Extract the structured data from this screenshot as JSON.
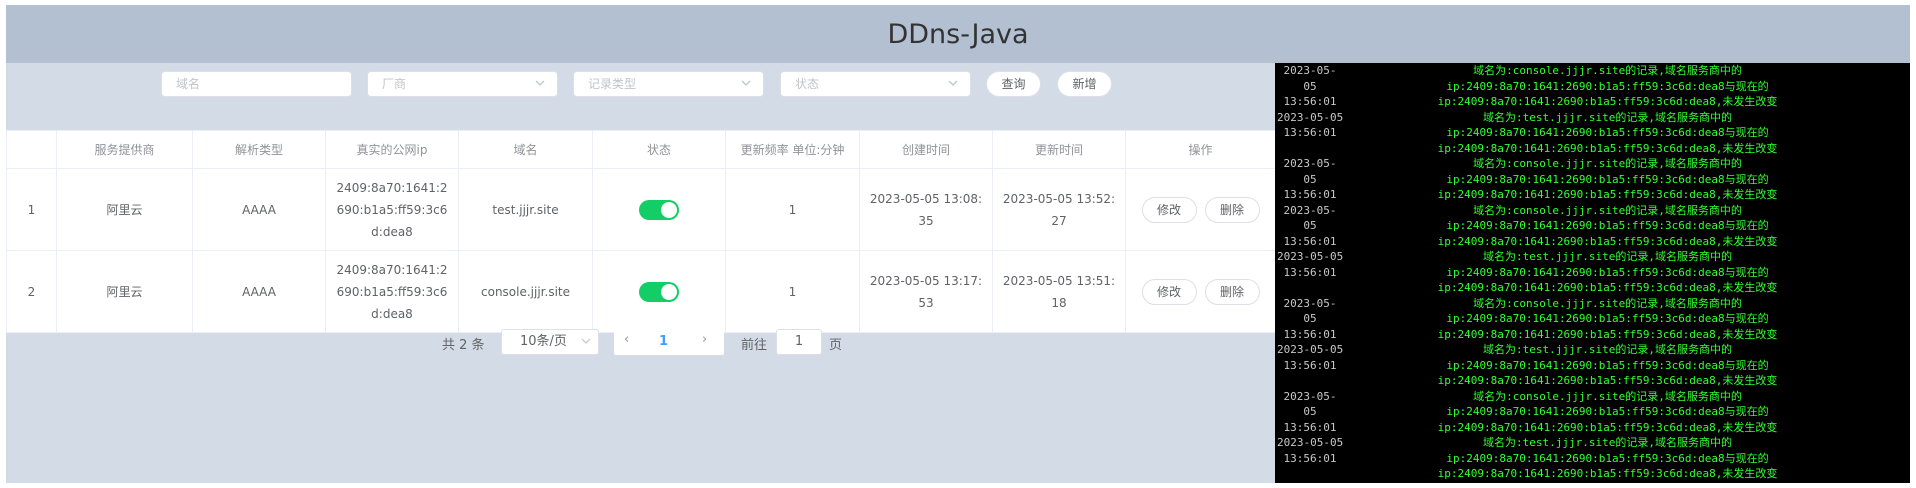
{
  "app": {
    "title": "DDns-Java"
  },
  "filters": {
    "domain_placeholder": "域名",
    "vendor_placeholder": "厂商",
    "record_type_placeholder": "记录类型",
    "status_placeholder": "状态",
    "query_label": "查询",
    "add_label": "新增"
  },
  "table": {
    "headers": [
      "",
      "服务提供商",
      "解析类型",
      "真实的公网ip",
      "域名",
      "状态",
      "更新频率 单位:分钟",
      "创建时间",
      "更新时间",
      "操作"
    ],
    "rows": [
      {
        "index": "1",
        "provider": "阿里云",
        "type": "AAAA",
        "ip": "2409:8a70:1641:2690:b1a5:ff59:3c6d:dea8",
        "domain": "test.jjjr.site",
        "status_on": true,
        "frequency": "1",
        "created": "2023-05-05 13:08:35",
        "updated": "2023-05-05 13:52:27",
        "edit_label": "修改",
        "delete_label": "删除"
      },
      {
        "index": "2",
        "provider": "阿里云",
        "type": "AAAA",
        "ip": "2409:8a70:1641:2690:b1a5:ff59:3c6d:dea8",
        "domain": "console.jjjr.site",
        "status_on": true,
        "frequency": "1",
        "created": "2023-05-05 13:17:53",
        "updated": "2023-05-05 13:51:18",
        "edit_label": "修改",
        "delete_label": "删除"
      }
    ]
  },
  "pagination": {
    "total": "共 2 条",
    "page_size": "10条/页",
    "current_page": "1",
    "goto_label": "前往",
    "goto_value": "1",
    "page_suffix": "页"
  },
  "console": {
    "logs": [
      {
        "ts": "2023-05-\n05\n13:56:01",
        "msg": "域名为:console.jjjr.site的记录,域名服务商中的\nip:2409:8a70:1641:2690:b1a5:ff59:3c6d:dea8与现在的\nip:2409:8a70:1641:2690:b1a5:ff59:3c6d:dea8,未发生改变"
      },
      {
        "ts": "2023-05-05\n13:56:01",
        "msg": "域名为:test.jjjr.site的记录,域名服务商中的\nip:2409:8a70:1641:2690:b1a5:ff59:3c6d:dea8与现在的\nip:2409:8a70:1641:2690:b1a5:ff59:3c6d:dea8,未发生改变"
      },
      {
        "ts": "2023-05-\n05\n13:56:01",
        "msg": "域名为:console.jjjr.site的记录,域名服务商中的\nip:2409:8a70:1641:2690:b1a5:ff59:3c6d:dea8与现在的\nip:2409:8a70:1641:2690:b1a5:ff59:3c6d:dea8,未发生改变"
      },
      {
        "ts": "2023-05-\n05\n13:56:01",
        "msg": "域名为:console.jjjr.site的记录,域名服务商中的\nip:2409:8a70:1641:2690:b1a5:ff59:3c6d:dea8与现在的\nip:2409:8a70:1641:2690:b1a5:ff59:3c6d:dea8,未发生改变"
      },
      {
        "ts": "2023-05-05\n13:56:01",
        "msg": "域名为:test.jjjr.site的记录,域名服务商中的\nip:2409:8a70:1641:2690:b1a5:ff59:3c6d:dea8与现在的\nip:2409:8a70:1641:2690:b1a5:ff59:3c6d:dea8,未发生改变"
      },
      {
        "ts": "2023-05-\n05\n13:56:01",
        "msg": "域名为:console.jjjr.site的记录,域名服务商中的\nip:2409:8a70:1641:2690:b1a5:ff59:3c6d:dea8与现在的\nip:2409:8a70:1641:2690:b1a5:ff59:3c6d:dea8,未发生改变"
      },
      {
        "ts": "2023-05-05\n13:56:01",
        "msg": "域名为:test.jjjr.site的记录,域名服务商中的\nip:2409:8a70:1641:2690:b1a5:ff59:3c6d:dea8与现在的\nip:2409:8a70:1641:2690:b1a5:ff59:3c6d:dea8,未发生改变"
      },
      {
        "ts": "2023-05-\n05\n13:56:01",
        "msg": "域名为:console.jjjr.site的记录,域名服务商中的\nip:2409:8a70:1641:2690:b1a5:ff59:3c6d:dea8与现在的\nip:2409:8a70:1641:2690:b1a5:ff59:3c6d:dea8,未发生改变"
      },
      {
        "ts": "2023-05-05\n13:56:01",
        "msg": "域名为:test.jjjr.site的记录,域名服务商中的\nip:2409:8a70:1641:2690:b1a5:ff59:3c6d:dea8与现在的\nip:2409:8a70:1641:2690:b1a5:ff59:3c6d:dea8,未发生改变"
      }
    ]
  },
  "colors": {
    "header_bg": "#b3c0d1",
    "main_bg": "#d3dce6",
    "switch_on": "#13ce66",
    "console_bg": "#000000",
    "console_text": "#33ff33",
    "accent": "#409eff"
  }
}
